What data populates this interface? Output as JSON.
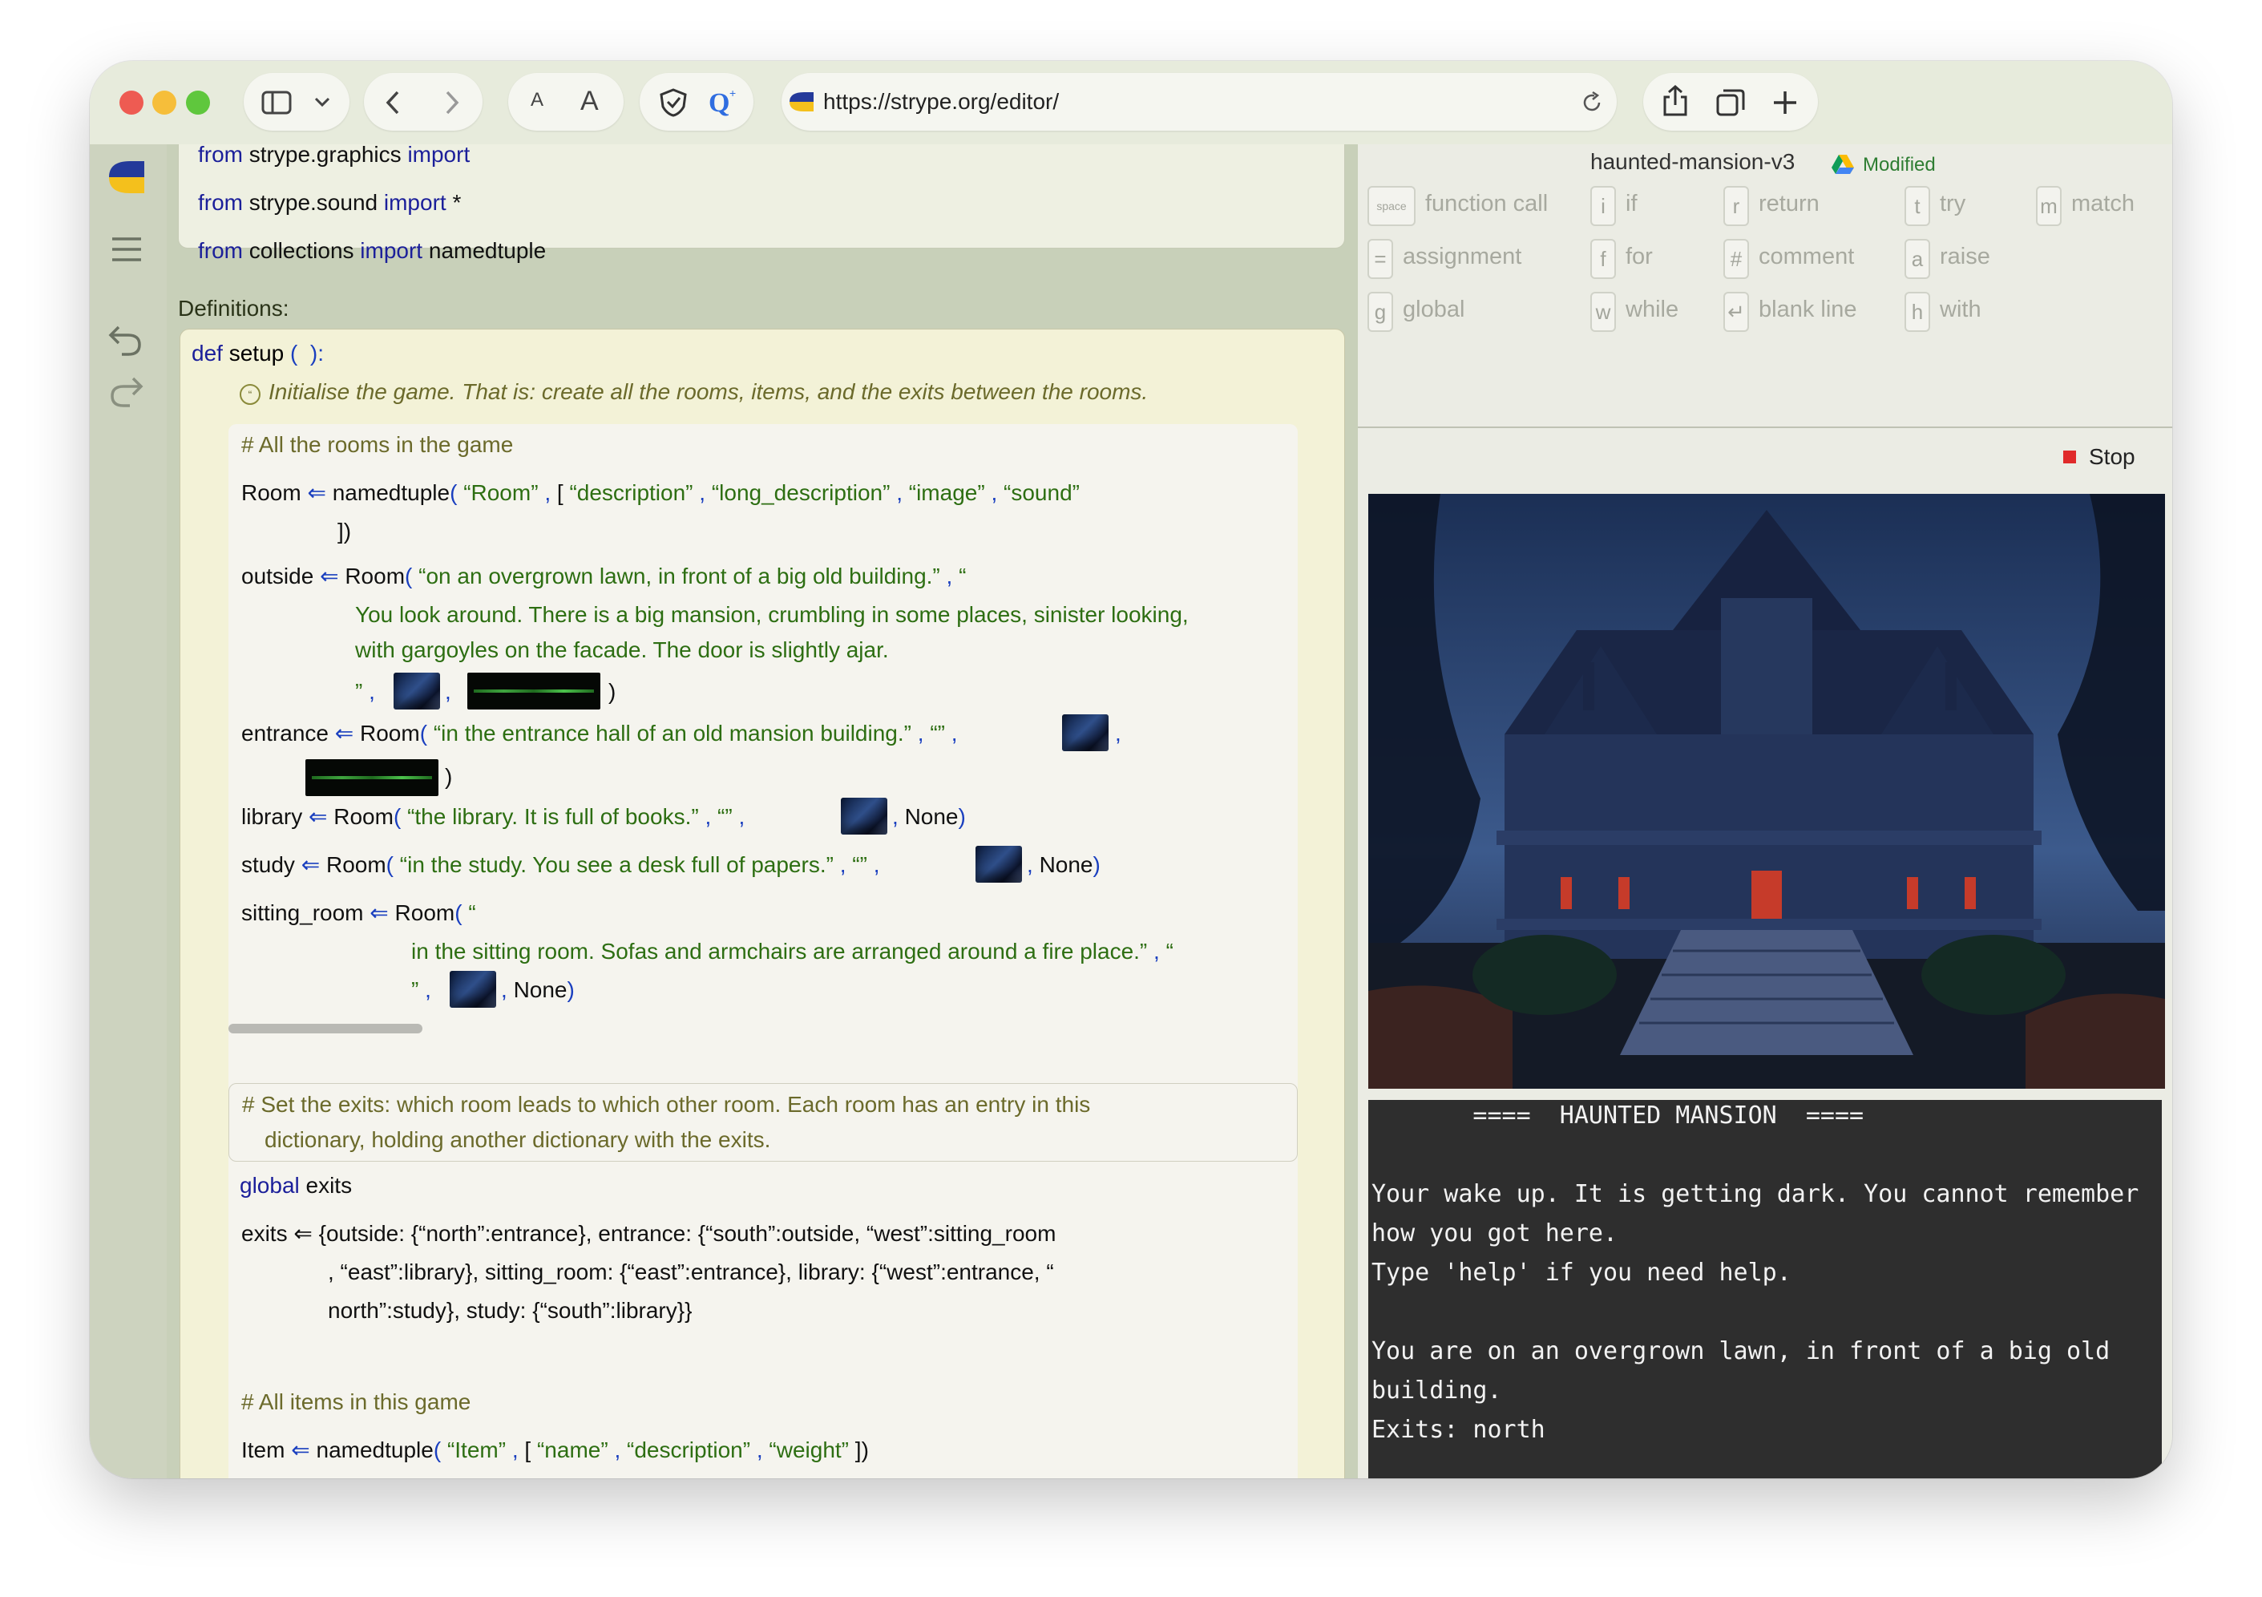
{
  "browser": {
    "url": "https://strype.org/editor/",
    "font_small": "A",
    "font_large": "A"
  },
  "project": {
    "name": "haunted-mansion-v3",
    "status": "Modified"
  },
  "shortcuts": [
    {
      "key": "space",
      "label": "function call"
    },
    {
      "key": "i",
      "label": "if"
    },
    {
      "key": "r",
      "label": "return"
    },
    {
      "key": "t",
      "label": "try"
    },
    {
      "key": "m",
      "label": "match"
    },
    {
      "key": "=",
      "label": "assignment"
    },
    {
      "key": "f",
      "label": "for"
    },
    {
      "key": "#",
      "label": "comment"
    },
    {
      "key": "a",
      "label": "raise"
    },
    {
      "key": "g",
      "label": "global"
    },
    {
      "key": "w",
      "label": "while"
    },
    {
      "key": "↵",
      "label": "blank line"
    },
    {
      "key": "h",
      "label": "with"
    }
  ],
  "stop_label": "Stop",
  "code": {
    "imports": {
      "i1": {
        "from": "from",
        "module": "strype.graphics",
        "import": "import"
      },
      "i2": {
        "from": "from",
        "module": "strype.sound",
        "import": "import",
        "star": "*"
      },
      "i3": {
        "from": "from",
        "module": "collections",
        "import": "import",
        "name": "namedtuple"
      }
    },
    "definitions_label": "Definitions:",
    "def": {
      "kw": "def",
      "name": "setup",
      "lparen": "(",
      "rparen": "):"
    },
    "docstring": "Initialise the game. That is: create all the rooms, items, and the exits between the rooms.",
    "comment_rooms": "# All the rooms in the game",
    "room_tuple": {
      "var": "Room",
      "arrow": "⇐",
      "fn": "namedtuple",
      "lp": "(",
      "s1": "“Room”",
      "c1": ",",
      "lb": "[",
      "f1": "“description”",
      "c2": ",",
      "f2": "“long_description”",
      "c3": ",",
      "f3": "“image”",
      "c4": ",",
      "f4": "“sound”",
      "close": "])"
    },
    "outside": {
      "var": "outside",
      "arrow": "⇐",
      "fn": "Room",
      "lp": "(",
      "s1": "“on an overgrown lawn, in front of a big old building.”",
      "c1": ",",
      "q": "“",
      "long1": "You look around. There is a big mansion, crumbling in some places, sinister looking,",
      "long2": "with gargoyles on the facade. The door is slightly ajar.",
      "endq": "”",
      "c2": ",",
      "c3": ",",
      "close": ")"
    },
    "entrance": {
      "var": "entrance",
      "arrow": "⇐",
      "fn": "Room",
      "lp": "(",
      "s1": "“in the entrance hall of an old mansion building.”",
      "c1": ",",
      "s2": "“”",
      "c2": ",",
      "c3": ",",
      "close": ")"
    },
    "library": {
      "var": "library",
      "arrow": "⇐",
      "fn": "Room",
      "lp": "(",
      "s1": "“the library. It is full of books.”",
      "c1": ",",
      "s2": "“”",
      "c2": ",",
      "c3": ",",
      "none": "None",
      "close": ")"
    },
    "study": {
      "var": "study",
      "arrow": "⇐",
      "fn": "Room",
      "lp": "(",
      "s1": "“in the study. You see a desk full of papers.”",
      "c1": ",",
      "s2": "“”",
      "c2": ",",
      "c3": ",",
      "none": "None",
      "close": ")"
    },
    "sitting": {
      "var": "sitting_room",
      "arrow": "⇐",
      "fn": "Room",
      "lp": "(",
      "q": "“",
      "s1": "in the sitting room. Sofas and armchairs are arranged around a fire place.”",
      "c1": ",",
      "q2": "“",
      "endq": "”",
      "c2": ",",
      "c3": ",",
      "none": "None",
      "close": ")"
    },
    "comment_exits_1": "# Set the exits: which room leads to which other room. Each room has an entry in this",
    "comment_exits_2": "dictionary, holding another dictionary with the exits.",
    "global": {
      "kw": "global",
      "name": "exits"
    },
    "exits_line1": "exits ⇐ {outside: {“north”:entrance}, entrance: {“south”:outside, “west”:sitting_room",
    "exits_line2": ", “east”:library}, sitting_room: {“east”:entrance}, library: {“west”:entrance, “",
    "exits_line3": "north”:study}, study: {“south”:library}}",
    "comment_items": "# All items in this game",
    "item_tuple": {
      "var": "Item",
      "arrow": "⇐",
      "fn": "namedtuple",
      "lp": "(",
      "s1": "“Item”",
      "c1": ",",
      "lb": "[",
      "f1": "“name”",
      "c2": ",",
      "f2": "“description”",
      "c3": ",",
      "f3": "“weight”",
      "close": "])"
    }
  },
  "console_lines": [
    "       ====  HAUNTED MANSION  ====",
    "",
    "Your wake up. It is getting dark. You cannot remember",
    "how you got here.",
    "Type 'help' if you need help.",
    "",
    "You are on an overgrown lawn, in front of a big old",
    "building.",
    "Exits: north",
    "",
    ">"
  ]
}
